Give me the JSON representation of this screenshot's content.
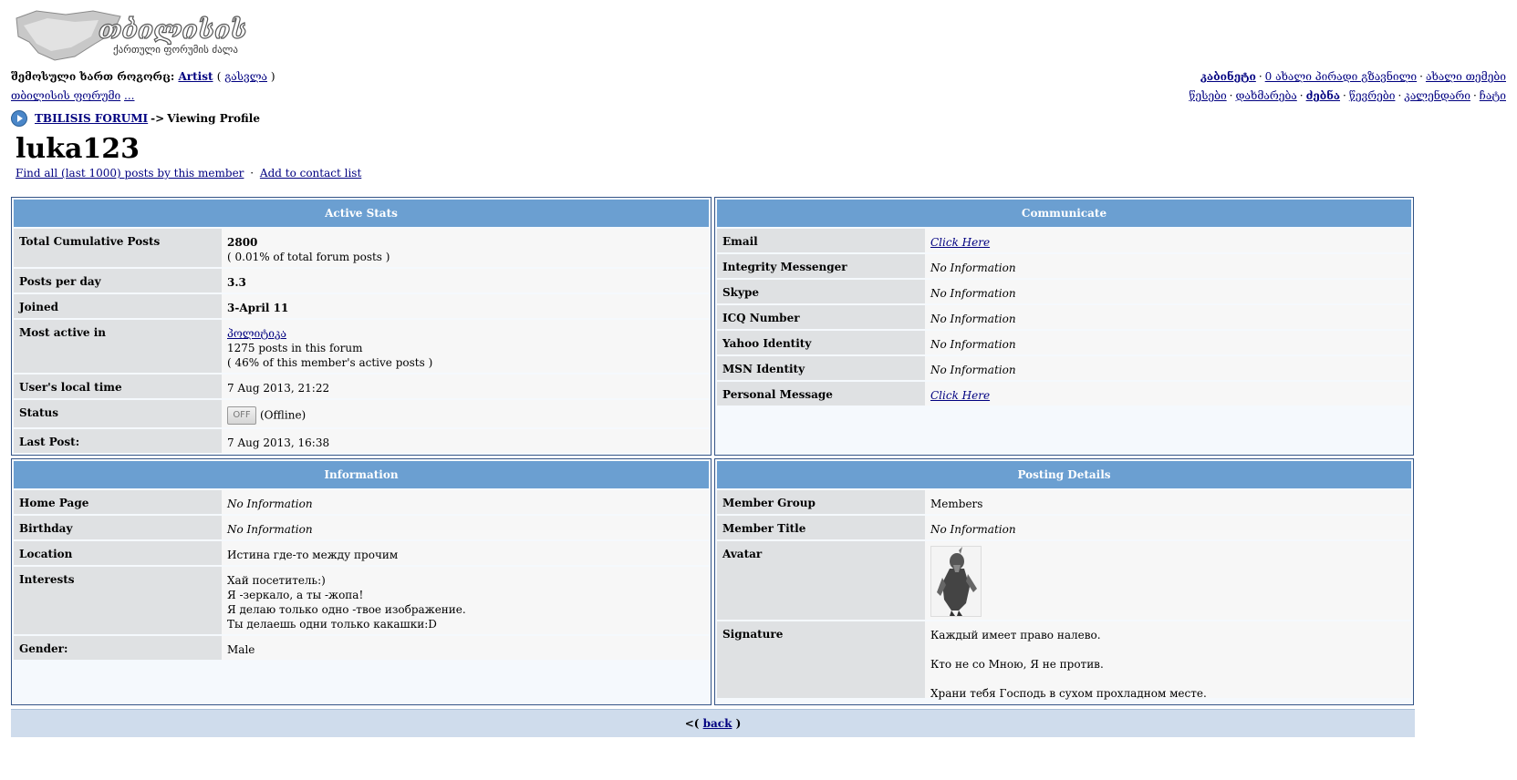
{
  "header": {
    "logo_alt": "თბილისის ფორუმი",
    "logo_sub": "ქართული ფორუმის ძალა",
    "logged_in_prefix": "შემოსული ხართ როგორც:",
    "username": "Artist",
    "logout_label": "გასვლა",
    "forum_link": "თბილისის ფორუმი",
    "forum_more": "...",
    "right_top": {
      "cabinet": "კაბინეტი",
      "new_pm": "0 ახალი პირადი გზავნილი",
      "new_topic": "ახალი თემები"
    },
    "right_nav": [
      "წესები",
      "დახმარება",
      "ძებნა",
      "წევრები",
      "კალენდარი",
      "ჩატი"
    ]
  },
  "breadcrumb": {
    "root": "TBILISIS FORUMI",
    "arrow": "->",
    "current": "Viewing Profile"
  },
  "profile": {
    "name": "luka123",
    "link_find_posts": "Find all (last 1000) posts by this member",
    "link_add_contact": "Add to contact list"
  },
  "active_stats": {
    "title": "Active Stats",
    "total_posts_label": "Total Cumulative Posts",
    "total_posts_value": "2800",
    "total_posts_pct": "( 0.01% of total forum posts )",
    "per_day_label": "Posts per day",
    "per_day_value": "3.3",
    "joined_label": "Joined",
    "joined_value": "3-April 11",
    "most_active_label": "Most active in",
    "most_active_forum": "პოლიტიკა",
    "most_active_posts": "1275 posts in this forum",
    "most_active_pct": "( 46% of this member's active posts )",
    "local_time_label": "User's local time",
    "local_time_value": "7 Aug 2013, 21:22",
    "status_label": "Status",
    "status_button": "OFF",
    "status_text": "(Offline)",
    "last_post_label": "Last Post:",
    "last_post_value": "7 Aug 2013, 16:38"
  },
  "communicate": {
    "title": "Communicate",
    "rows": [
      {
        "label": "Email",
        "value": "Click Here",
        "link": true
      },
      {
        "label": "Integrity Messenger",
        "value": "No Information",
        "link": false
      },
      {
        "label": "Skype",
        "value": "No Information",
        "link": false
      },
      {
        "label": "ICQ Number",
        "value": "No Information",
        "link": false
      },
      {
        "label": "Yahoo Identity",
        "value": "No Information",
        "link": false
      },
      {
        "label": "MSN Identity",
        "value": "No Information",
        "link": false
      },
      {
        "label": "Personal Message",
        "value": "Click Here",
        "link": true
      }
    ]
  },
  "information": {
    "title": "Information",
    "home_label": "Home Page",
    "home_value": "No Information",
    "birthday_label": "Birthday",
    "birthday_value": "No Information",
    "location_label": "Location",
    "location_value": "Истина где-то между прочим",
    "interests_label": "Interests",
    "interests_lines": [
      "Хай посетитель:)",
      "Я -зеркало, а ты -жопа!",
      "Я делаю только одно -твое изображение.",
      "Ты делаешь одни только какашки:D"
    ],
    "gender_label": "Gender:",
    "gender_value": "Male"
  },
  "posting_details": {
    "title": "Posting Details",
    "group_label": "Member Group",
    "group_value": "Members",
    "mtitle_label": "Member Title",
    "mtitle_value": "No Information",
    "avatar_label": "Avatar",
    "signature_label": "Signature",
    "signature_lines": [
      "Каждый имеет право налево.",
      "Кто не со Мною, Я не против.",
      "Храни тебя Господь в сухом прохладном месте."
    ]
  },
  "footer": {
    "open": "<(",
    "back_label": "back",
    "close": ")"
  }
}
